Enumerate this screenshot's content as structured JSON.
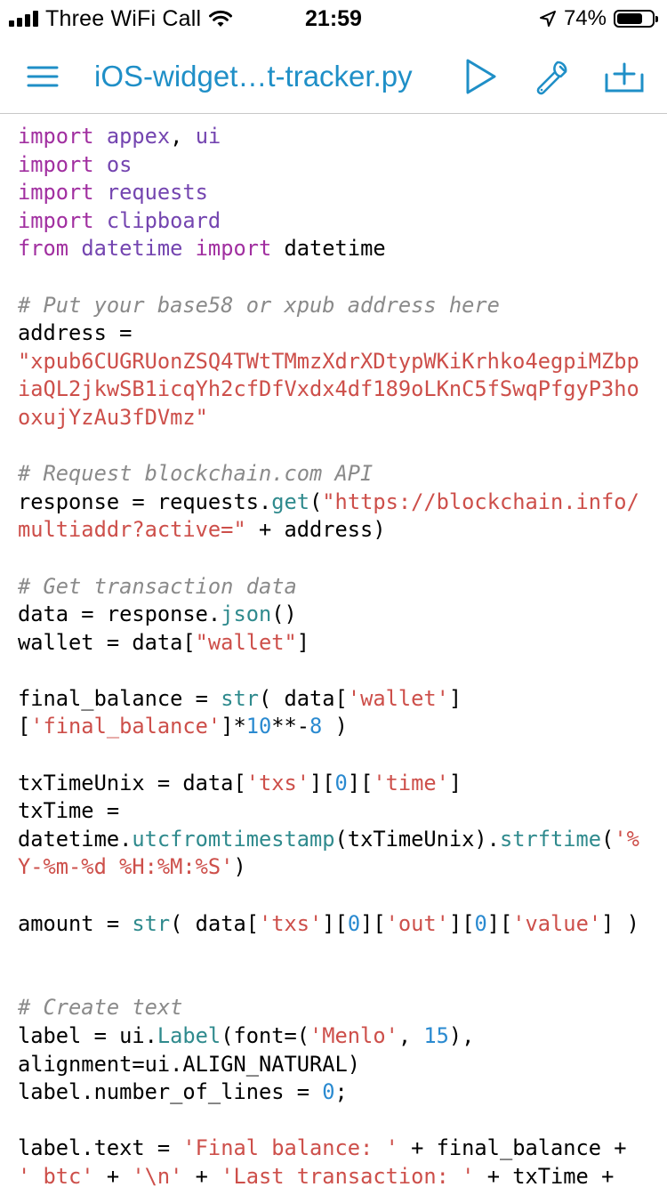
{
  "status_bar": {
    "carrier": "Three WiFi Call",
    "time": "21:59",
    "battery_percent": "74%",
    "battery_level": 0.74
  },
  "nav": {
    "title": "iOS-widget…t-tracker.py",
    "accent_color": "#1f8fc7",
    "icons": [
      "menu-icon",
      "play-icon",
      "wrench-icon",
      "add-icon"
    ]
  },
  "code": {
    "lines": [
      [
        {
          "t": "import",
          "c": "kw"
        },
        {
          "t": " "
        },
        {
          "t": "appex",
          "c": "mod"
        },
        {
          "t": ", "
        },
        {
          "t": "ui",
          "c": "mod"
        }
      ],
      [
        {
          "t": "import",
          "c": "kw"
        },
        {
          "t": " "
        },
        {
          "t": "os",
          "c": "mod"
        }
      ],
      [
        {
          "t": "import",
          "c": "kw"
        },
        {
          "t": " "
        },
        {
          "t": "requests",
          "c": "mod"
        }
      ],
      [
        {
          "t": "import",
          "c": "kw"
        },
        {
          "t": " "
        },
        {
          "t": "clipboard",
          "c": "mod"
        }
      ],
      [
        {
          "t": "from",
          "c": "kw"
        },
        {
          "t": " "
        },
        {
          "t": "datetime",
          "c": "mod"
        },
        {
          "t": " "
        },
        {
          "t": "import",
          "c": "kw"
        },
        {
          "t": " datetime"
        }
      ],
      [],
      [
        {
          "t": "# Put your base58 or xpub address here",
          "c": "cmt"
        }
      ],
      [
        {
          "t": "address ="
        }
      ],
      [
        {
          "t": "\"xpub6CUGRUonZSQ4TWtTMmzXdrXDtypWKiKrhko4egpiMZbp",
          "c": "str"
        }
      ],
      [
        {
          "t": "iaQL2jkwSB1icqYh2cfDfVxdx4df189oLKnC5fSwqPfgyP3ho",
          "c": "str"
        }
      ],
      [
        {
          "t": "oxujYzAu3fDVmz\"",
          "c": "str"
        }
      ],
      [],
      [
        {
          "t": "# Request blockchain.com API",
          "c": "cmt"
        }
      ],
      [
        {
          "t": "response = requests."
        },
        {
          "t": "get",
          "c": "fn"
        },
        {
          "t": "("
        },
        {
          "t": "\"https://blockchain.info/",
          "c": "str"
        }
      ],
      [
        {
          "t": "multiaddr?active=\"",
          "c": "str"
        },
        {
          "t": " + address)"
        }
      ],
      [],
      [
        {
          "t": "# Get transaction data",
          "c": "cmt"
        }
      ],
      [
        {
          "t": "data = response."
        },
        {
          "t": "json",
          "c": "fn"
        },
        {
          "t": "()"
        }
      ],
      [
        {
          "t": "wallet = data["
        },
        {
          "t": "\"wallet\"",
          "c": "str"
        },
        {
          "t": "]"
        }
      ],
      [],
      [
        {
          "t": "final_balance = "
        },
        {
          "t": "str",
          "c": "fn"
        },
        {
          "t": "( data["
        },
        {
          "t": "'wallet'",
          "c": "str"
        },
        {
          "t": "]"
        }
      ],
      [
        {
          "t": "["
        },
        {
          "t": "'final_balance'",
          "c": "str"
        },
        {
          "t": "]*"
        },
        {
          "t": "10",
          "c": "num"
        },
        {
          "t": "**-"
        },
        {
          "t": "8",
          "c": "num"
        },
        {
          "t": " )"
        }
      ],
      [],
      [
        {
          "t": "txTimeUnix = data["
        },
        {
          "t": "'txs'",
          "c": "str"
        },
        {
          "t": "]["
        },
        {
          "t": "0",
          "c": "num"
        },
        {
          "t": "]["
        },
        {
          "t": "'time'",
          "c": "str"
        },
        {
          "t": "]"
        }
      ],
      [
        {
          "t": "txTime ="
        }
      ],
      [
        {
          "t": "datetime."
        },
        {
          "t": "utcfromtimestamp",
          "c": "fn"
        },
        {
          "t": "(txTimeUnix)."
        },
        {
          "t": "strftime",
          "c": "fn"
        },
        {
          "t": "("
        },
        {
          "t": "'%",
          "c": "str"
        }
      ],
      [
        {
          "t": "Y-%m-%d %H:%M:%S'",
          "c": "str"
        },
        {
          "t": ")"
        }
      ],
      [],
      [
        {
          "t": "amount = "
        },
        {
          "t": "str",
          "c": "fn"
        },
        {
          "t": "( data["
        },
        {
          "t": "'txs'",
          "c": "str"
        },
        {
          "t": "]["
        },
        {
          "t": "0",
          "c": "num"
        },
        {
          "t": "]["
        },
        {
          "t": "'out'",
          "c": "str"
        },
        {
          "t": "]["
        },
        {
          "t": "0",
          "c": "num"
        },
        {
          "t": "]["
        },
        {
          "t": "'value'",
          "c": "str"
        },
        {
          "t": "] )"
        }
      ],
      [],
      [],
      [
        {
          "t": "# Create text",
          "c": "cmt"
        }
      ],
      [
        {
          "t": "label = ui."
        },
        {
          "t": "Label",
          "c": "fn"
        },
        {
          "t": "(font=("
        },
        {
          "t": "'Menlo'",
          "c": "str"
        },
        {
          "t": ", "
        },
        {
          "t": "15",
          "c": "num"
        },
        {
          "t": "),"
        }
      ],
      [
        {
          "t": "alignment=ui.ALIGN_NATURAL)"
        }
      ],
      [
        {
          "t": "label.number_of_lines = "
        },
        {
          "t": "0",
          "c": "num"
        },
        {
          "t": ";"
        }
      ],
      [],
      [
        {
          "t": "label.text = "
        },
        {
          "t": "'Final balance: '",
          "c": "str"
        },
        {
          "t": " + final_balance +"
        }
      ],
      [
        {
          "t": "' btc'",
          "c": "str"
        },
        {
          "t": " + "
        },
        {
          "t": "'\\n'",
          "c": "str"
        },
        {
          "t": " + "
        },
        {
          "t": "'Last transaction: '",
          "c": "str"
        },
        {
          "t": " + txTime +"
        }
      ]
    ]
  }
}
